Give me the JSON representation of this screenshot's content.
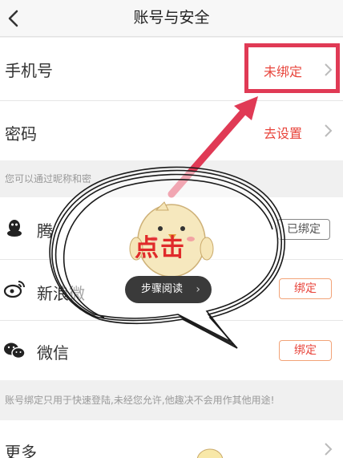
{
  "header": {
    "title": "账号与安全"
  },
  "rows": {
    "phone": {
      "label": "手机号",
      "value": "未绑定"
    },
    "password": {
      "label": "密码",
      "value": "去设置"
    },
    "qq": {
      "label": "腾",
      "action": "已绑定"
    },
    "weibo": {
      "label": "新浪微",
      "action": "绑定"
    },
    "wechat": {
      "label": "微信",
      "action": "绑定"
    },
    "more": {
      "label": "更多"
    }
  },
  "notes": {
    "nickname_hint": "您可以通过昵称和密",
    "bind_hint": "账号绑定只用于快速登陆,未经您允许,他趣决不会用作其他用途!"
  },
  "overlay": {
    "click_text": "点击",
    "step_button": "步骤阅读",
    "step_arrow": "›"
  },
  "colors": {
    "accent_red": "#e8453c",
    "highlight": "#e03a55",
    "bind_border": "#f2a378"
  },
  "icons": [
    "back-arrow-icon",
    "chevron-right-icon",
    "qq-penguin-icon",
    "weibo-icon",
    "wechat-icon"
  ]
}
